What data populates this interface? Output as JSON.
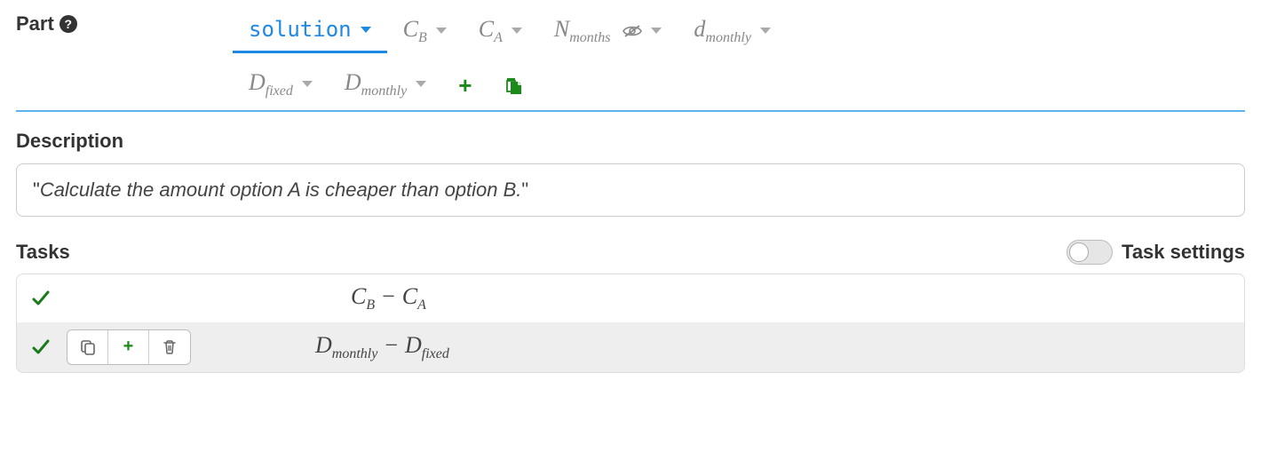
{
  "header": {
    "part_label": "Part"
  },
  "tabs_row1": [
    {
      "kind": "text",
      "label": "solution",
      "active": true,
      "hidden_icon": false
    },
    {
      "kind": "math",
      "var": "C",
      "sub": "B",
      "active": false,
      "hidden_icon": false
    },
    {
      "kind": "math",
      "var": "C",
      "sub": "A",
      "active": false,
      "hidden_icon": false
    },
    {
      "kind": "math",
      "var": "N",
      "sub": "months",
      "active": false,
      "hidden_icon": true
    },
    {
      "kind": "math",
      "var": "d",
      "sub": "monthly",
      "active": false,
      "hidden_icon": false
    }
  ],
  "tabs_row2": [
    {
      "kind": "math",
      "var": "D",
      "sub": "fixed",
      "active": false,
      "hidden_icon": false
    },
    {
      "kind": "math",
      "var": "D",
      "sub": "monthly",
      "active": false,
      "hidden_icon": false
    }
  ],
  "description": {
    "label": "Description",
    "text": "Calculate the amount option A is cheaper than option B."
  },
  "tasks": {
    "label": "Tasks",
    "settings_label": "Task settings",
    "rows": [
      {
        "has_actions": false,
        "expr": {
          "left_var": "C",
          "left_sub": "B",
          "op": "−",
          "right_var": "C",
          "right_sub": "A"
        }
      },
      {
        "has_actions": true,
        "expr": {
          "left_var": "D",
          "left_sub": "monthly",
          "op": "−",
          "right_var": "D",
          "right_sub": "fixed"
        }
      }
    ]
  },
  "colors": {
    "accent_blue": "#1e88e5",
    "accent_green": "#1b8a1b",
    "gray_text": "#888"
  }
}
